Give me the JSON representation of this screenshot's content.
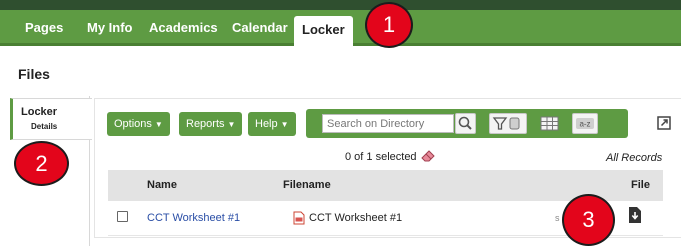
{
  "nav": {
    "tabs": [
      {
        "label": "Pages"
      },
      {
        "label": "My Info"
      },
      {
        "label": "Academics"
      },
      {
        "label": "Calendar"
      },
      {
        "label": "Locker"
      }
    ]
  },
  "page_title": "Files",
  "sidebar": {
    "item": {
      "title": "Locker",
      "subtitle": "Details"
    }
  },
  "toolbar": {
    "options_label": "Options",
    "reports_label": "Reports",
    "help_label": "Help",
    "search_placeholder": "Search on Directory"
  },
  "status": {
    "selected_text": "0 of 1 selected",
    "all_records": "All Records"
  },
  "table": {
    "headers": {
      "name": "Name",
      "filename": "Filename",
      "file": "File"
    },
    "rows": [
      {
        "name": "CCT Worksheet #1",
        "filename": "CCT Worksheet #1",
        "trunc": "s"
      }
    ]
  },
  "callouts": [
    {
      "label": "1"
    },
    {
      "label": "2"
    },
    {
      "label": "3"
    }
  ],
  "colors": {
    "nav_green": "#5e9b43",
    "callout_red": "#e3051b",
    "link_blue": "#2a4ea6",
    "header_gray": "#e3e3e3"
  },
  "icons": [
    "search-icon",
    "filter-icon",
    "grid-icon",
    "sort-az-icon",
    "expand-icon",
    "eraser-icon",
    "pdf-icon",
    "download-icon"
  ]
}
